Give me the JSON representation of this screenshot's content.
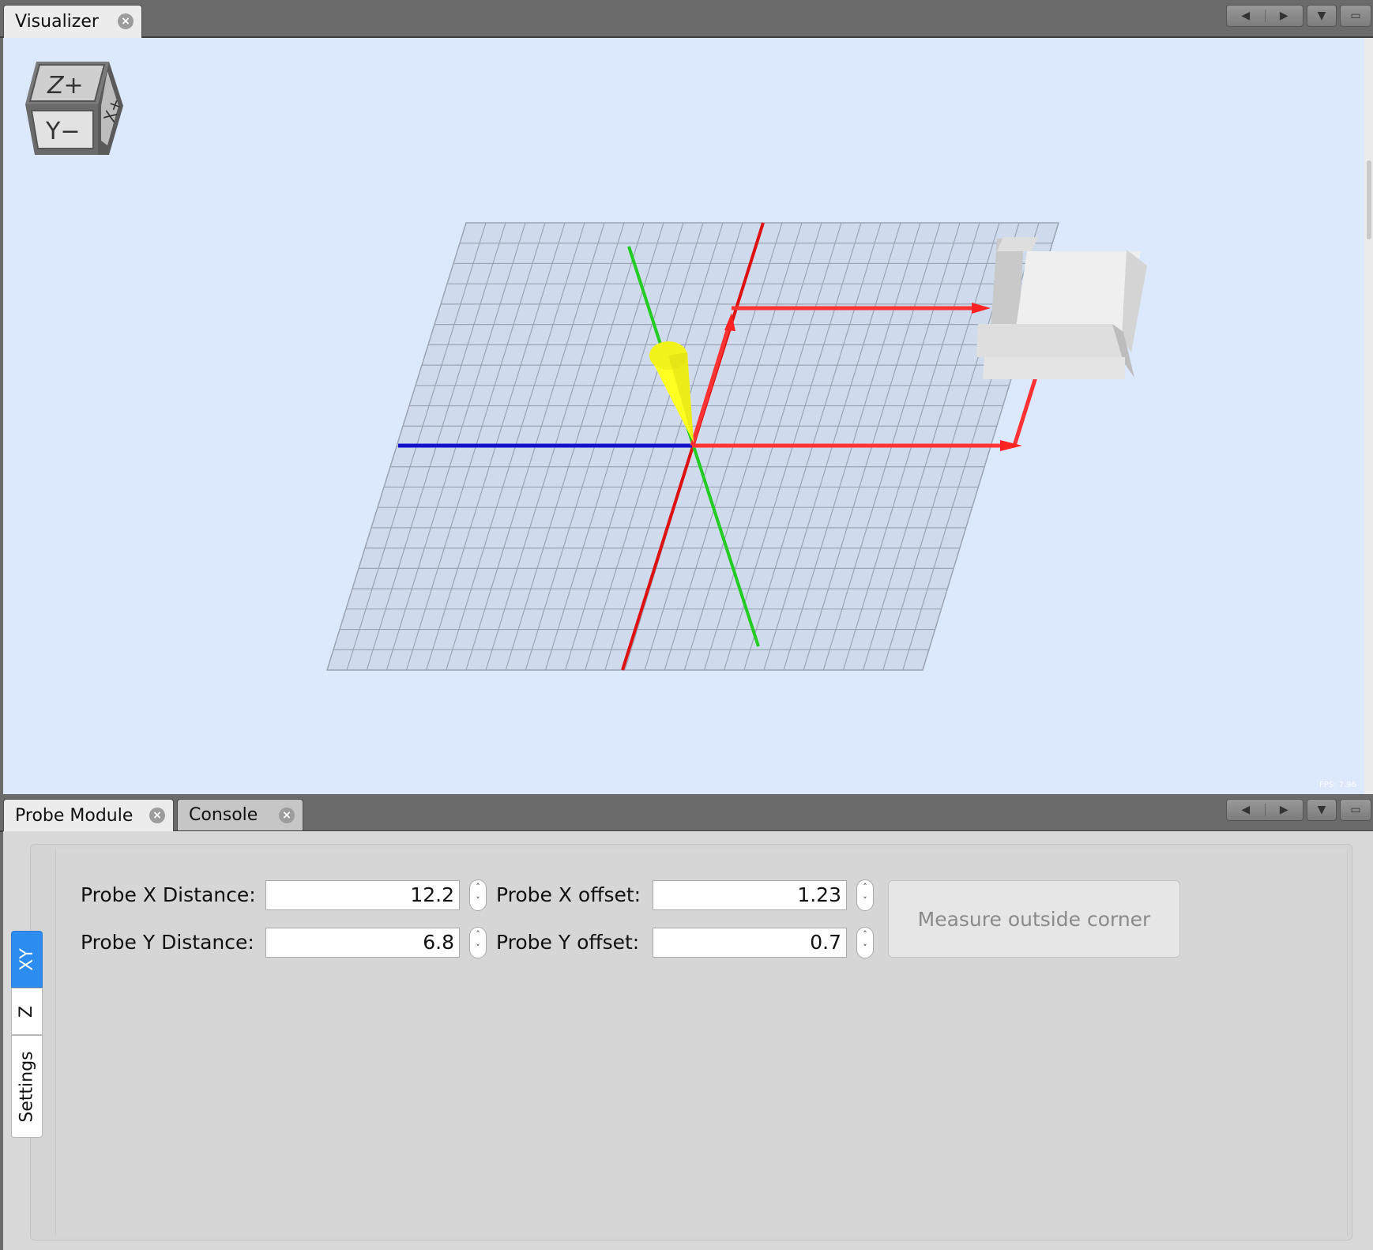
{
  "top_panel": {
    "tab_label": "Visualizer",
    "fps": "FPS: 7.96"
  },
  "view_cube": {
    "top_face": "Z+",
    "front_face": "Y−",
    "side_face": "X+"
  },
  "bottom_panel": {
    "tabs": [
      {
        "label": "Probe Module"
      },
      {
        "label": "Console"
      }
    ]
  },
  "side_tabs": [
    {
      "label": "XY",
      "active": true
    },
    {
      "label": "Z",
      "active": false
    },
    {
      "label": "Settings",
      "active": false
    }
  ],
  "form": {
    "probe_x_distance_label": "Probe X Distance:",
    "probe_x_distance_value": "12.2",
    "probe_y_distance_label": "Probe Y Distance:",
    "probe_y_distance_value": "6.8",
    "probe_x_offset_label": "Probe X offset:",
    "probe_x_offset_value": "1.23",
    "probe_y_offset_label": "Probe Y offset:",
    "probe_y_offset_value": "0.7",
    "measure_button_label": "Measure outside corner"
  },
  "colors": {
    "viz_background": "#dce8fb",
    "grid_fill": "#cfdaec",
    "x_axis": "#dd1111",
    "y_axis": "#22cc22",
    "z_axis": "#1111cc",
    "probe_path": "#ff3333",
    "tool": "#ffff22",
    "active_side_tab": "#2d8cf0"
  }
}
